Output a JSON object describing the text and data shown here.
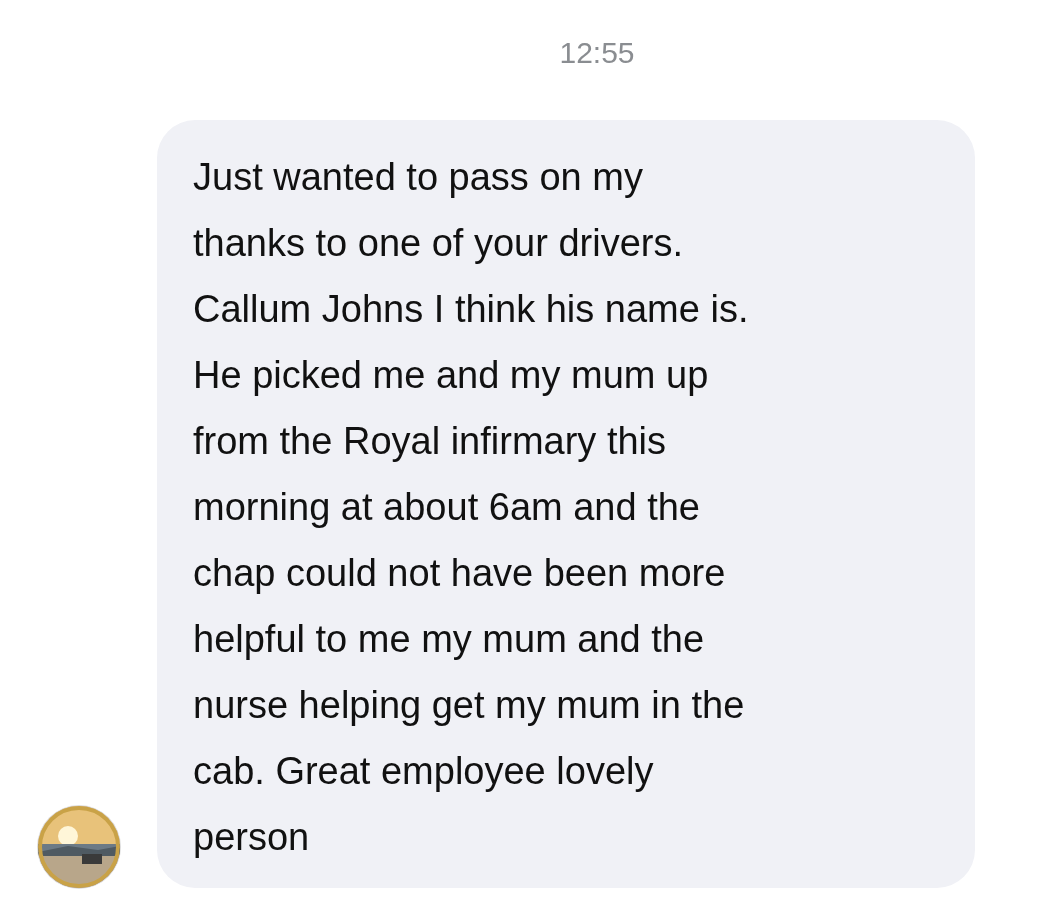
{
  "timestamp": "12:55",
  "message": {
    "lines": [
      "Just wanted to pass on my",
      "thanks to one of your drivers.",
      "Callum Johns I think his name is.",
      "He picked me and my mum up",
      "from the Royal infirmary this",
      "morning at about 6am and the",
      "chap could not have been more",
      "helpful to me my mum and the",
      "nurse helping get my mum in the",
      "cab. Great employee lovely",
      "person"
    ]
  }
}
